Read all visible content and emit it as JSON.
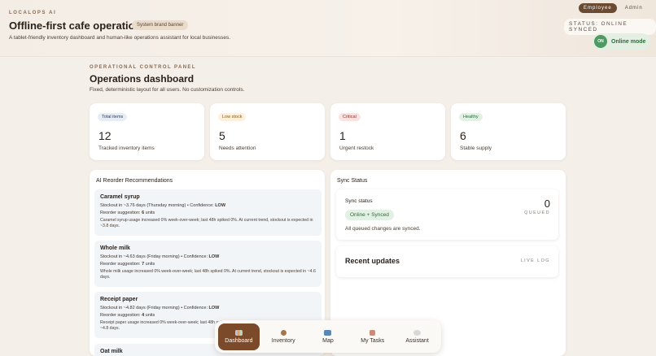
{
  "header": {
    "kicker": "LOCALOPS AI",
    "title": "Offline-first cafe operations",
    "badge": "System brand banner",
    "subtitle": "A tablet-friendly inventory dashboard and human-like operations assistant for local businesses.",
    "roles": {
      "employee": "Employee",
      "admin": "Admin",
      "active": "Employee"
    },
    "status": "STATUS: ONLINE SYNCED",
    "mode_dot": "ON",
    "mode_label": "Online mode"
  },
  "panel": {
    "kicker": "OPERATIONAL CONTROL PANEL",
    "title": "Operations dashboard",
    "subtitle": "Fixed, deterministic layout for all users. No customization controls."
  },
  "stats": [
    {
      "tag": "Total items",
      "value": "12",
      "caption": "Tracked inventory items"
    },
    {
      "tag": "Low stock",
      "value": "5",
      "caption": "Needs attention"
    },
    {
      "tag": "Critical",
      "value": "1",
      "caption": "Urgent restock"
    },
    {
      "tag": "Healthy",
      "value": "6",
      "caption": "Stable supply"
    }
  ],
  "recommendations": {
    "title": "AI Reorder Recommendations",
    "items": [
      {
        "name": "Caramel syrup",
        "stockout": "Stockout in ~3.76 days (Thursday morning) • Confidence: ",
        "confidence": "LOW",
        "reorder_prefix": "Reorder suggestion: ",
        "reorder_units": "6",
        "reorder_suffix": " units",
        "note": "Caramel syrup usage increased 0% week-over-week; last 48h spiked 0%. At current trend, stockout is expected in ~3.8 days."
      },
      {
        "name": "Whole milk",
        "stockout": "Stockout in ~4.63 days (Friday morning) • Confidence: ",
        "confidence": "LOW",
        "reorder_prefix": "Reorder suggestion: ",
        "reorder_units": "7",
        "reorder_suffix": " units",
        "note": "Whole milk usage increased 0% week-over-week; last 48h spiked 0%. At current trend, stockout is expected in ~4.6 days."
      },
      {
        "name": "Receipt paper",
        "stockout": "Stockout in ~4.82 days (Friday morning) • Confidence: ",
        "confidence": "LOW",
        "reorder_prefix": "Reorder suggestion: ",
        "reorder_units": "4",
        "reorder_suffix": " units",
        "note": "Receipt paper usage increased 0% week-over-week; last 48h spiked 0%. At current trend, stockout is expected in ~4.8 days."
      },
      {
        "name": "Oat milk"
      }
    ]
  },
  "sync": {
    "title": "Sync Status",
    "label": "Sync status",
    "state": "Online + Synced",
    "queued_count": "0",
    "queued_label": "QUEUED",
    "message": "All queued changes are synced."
  },
  "updates": {
    "title": "Recent updates",
    "live": "LIVE LOG"
  },
  "nav": {
    "items": [
      {
        "label": "Dashboard",
        "icon": "chart-icon",
        "active": true
      },
      {
        "label": "Inventory",
        "icon": "box-icon"
      },
      {
        "label": "Map",
        "icon": "map-icon"
      },
      {
        "label": "My Tasks",
        "icon": "clipboard-icon"
      },
      {
        "label": "Assistant",
        "icon": "chat-icon"
      }
    ]
  },
  "colors": {
    "accent": "#7a4a2a",
    "online": "#4f9a62",
    "background": "#f4efe8"
  }
}
